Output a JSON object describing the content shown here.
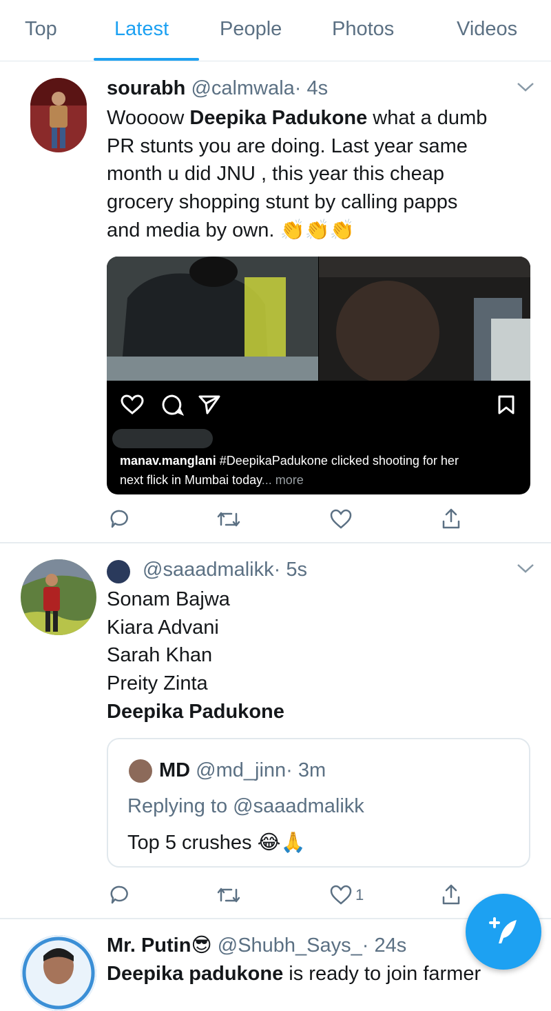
{
  "tabs": [
    "Top",
    "Latest",
    "People",
    "Photos",
    "Videos"
  ],
  "active_tab": "Latest",
  "colors": {
    "accent": "#1da1f2",
    "text": "#14171a",
    "muted": "#5b7083",
    "divider": "#e6ecf0"
  },
  "tweet1": {
    "name": "sourabh",
    "handle": "@calmwala",
    "time": "· 4s",
    "text_lines": [
      {
        "a": "Woooow ",
        "b": "Deepika Padukone",
        "c": " what a dumb"
      },
      "PR stunts you are doing. Last year same",
      "month u did JNU , this year this cheap",
      "grocery shopping stunt by calling papps",
      "and media by own. 👏👏👏"
    ],
    "embed": {
      "caption_user": "manav.manglani",
      "caption_rest": " #DeepikaPadukone clicked shooting for her",
      "caption_line2": "next flick in Mumbai today",
      "more": "... more"
    }
  },
  "tweet2": {
    "handle": "@saaadmalikk",
    "time": "· 5s",
    "lines": [
      "Sonam Bajwa",
      "Kiara Advani",
      "Sarah Khan",
      "Preity Zinta"
    ],
    "bold_line": "Deepika Padukone",
    "quote": {
      "name": "MD",
      "handle": "@md_jinn",
      "time": "· 3m",
      "replying": "Replying to @saaadmalikk",
      "text": "Top 5 crushes 😂🙏"
    },
    "like_count": "1"
  },
  "tweet3": {
    "name": "Mr. Putin😎",
    "handle": "@Shubh_Says_",
    "time": "· 24s",
    "text_bold": "Deepika padukone",
    "text_rest": " is ready to join farmer"
  },
  "icons": {
    "reply": "reply-icon",
    "retweet": "retweet-icon",
    "like": "heart-icon",
    "share": "share-icon",
    "compose": "compose-tweet-icon",
    "more": "chevron-down-icon"
  }
}
